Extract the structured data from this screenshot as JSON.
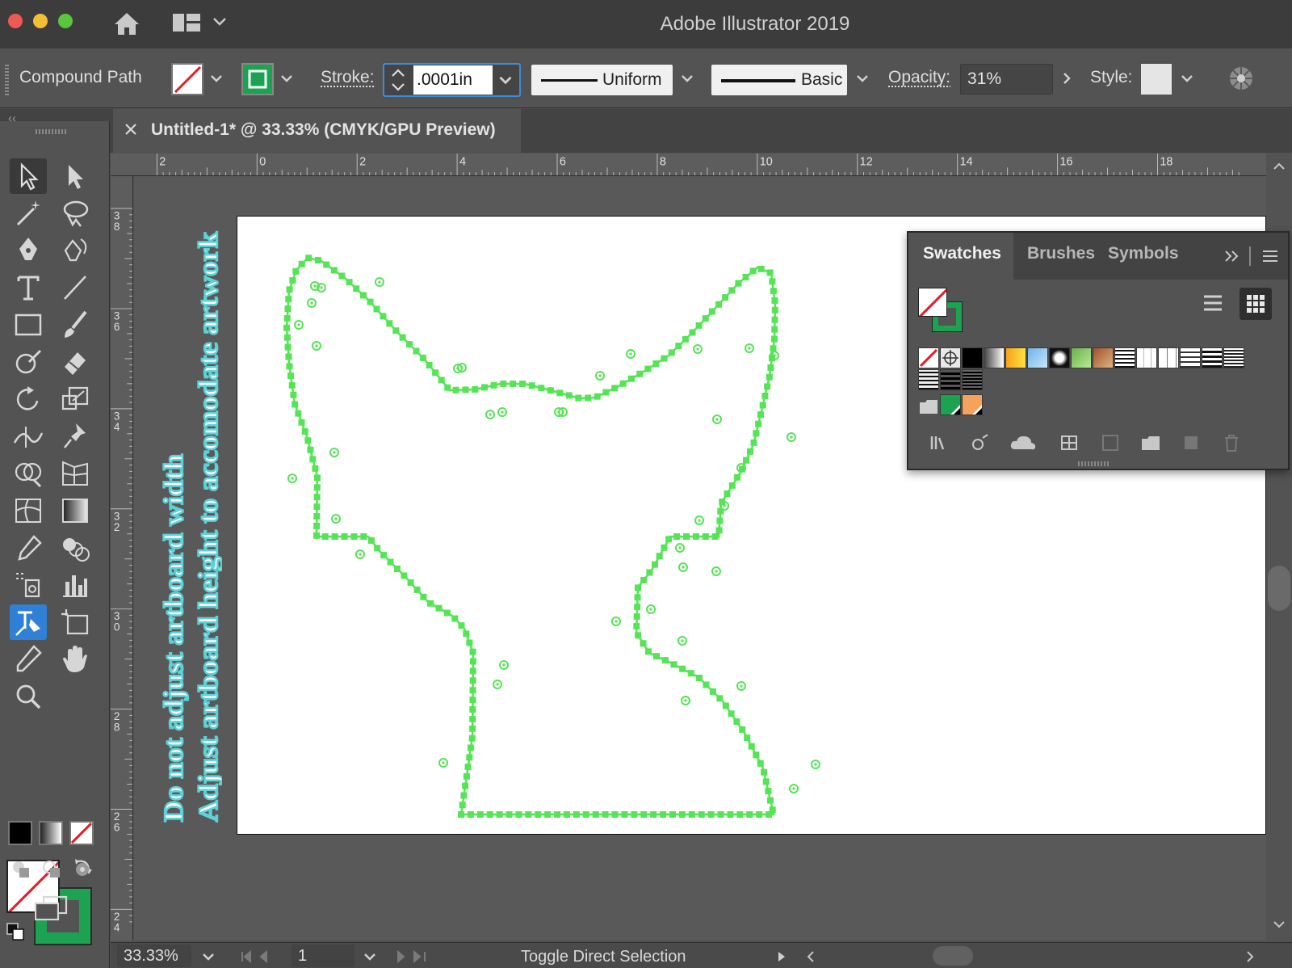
{
  "app": {
    "title": "Adobe Illustrator 2019"
  },
  "control_bar": {
    "selection_label": "Compound Path",
    "stroke_label": "Stroke:",
    "stroke_value": ".0001in",
    "profile_label": "Uniform",
    "brush_label": "Basic",
    "opacity_label": "Opacity:",
    "opacity_value": "31%",
    "style_label": "Style:"
  },
  "document_tab": {
    "title": "Untitled-1* @ 33.33% (CMYK/GPU Preview)"
  },
  "ruler": {
    "horizontal_ticks": [
      "2",
      "0",
      "2",
      "4",
      "6",
      "8",
      "10",
      "12",
      "14",
      "16",
      "18"
    ],
    "vertical_ticks": [
      "38",
      "36",
      "34",
      "32",
      "30",
      "28",
      "26",
      "24"
    ]
  },
  "artboard": {
    "note_line_1": "Do not adjust artboard width",
    "note_line_2": "Adjust artboard height to accomodate artwork"
  },
  "swatches_panel": {
    "tabs": [
      "Swatches",
      "Brushes",
      "Symbols"
    ]
  },
  "status_bar": {
    "zoom_value": "33.33%",
    "artboard_number": "1",
    "status_text": "Toggle Direct Selection"
  },
  "colors": {
    "path_green": "#55e455",
    "stroke_green": "#1ba352",
    "note_cyan": "#5fd0d8",
    "accent_blue": "#3c8cd9"
  }
}
